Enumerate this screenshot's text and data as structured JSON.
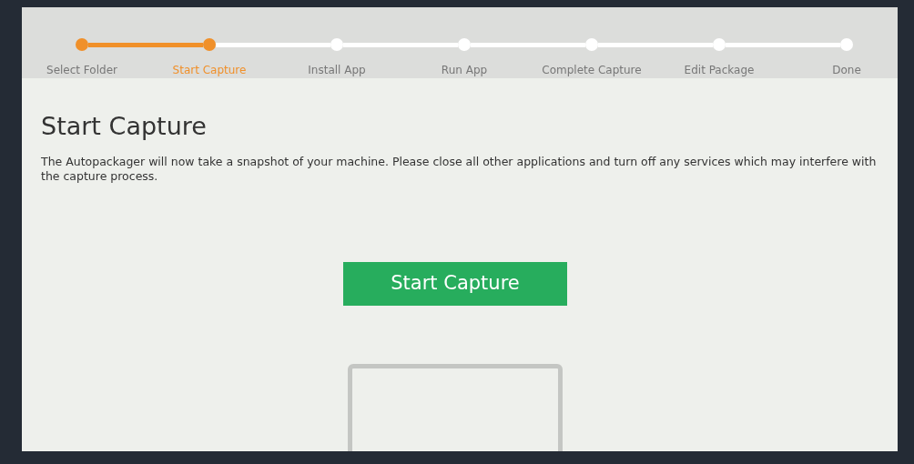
{
  "steps": [
    {
      "label": "Select Folder",
      "completed": true,
      "selected": false
    },
    {
      "label": "Start Capture",
      "completed": true,
      "selected": true
    },
    {
      "label": "Install App",
      "completed": false,
      "selected": false
    },
    {
      "label": "Run App",
      "completed": false,
      "selected": false
    },
    {
      "label": "Complete Capture",
      "completed": false,
      "selected": false
    },
    {
      "label": "Edit Package",
      "completed": false,
      "selected": false
    },
    {
      "label": "Done",
      "completed": false,
      "selected": false
    }
  ],
  "heading": "Start Capture",
  "description": "The Autopackager will now take a snapshot of your machine. Please close all other applications and turn off any services which may interfere with the capture process.",
  "button": "Start Capture"
}
